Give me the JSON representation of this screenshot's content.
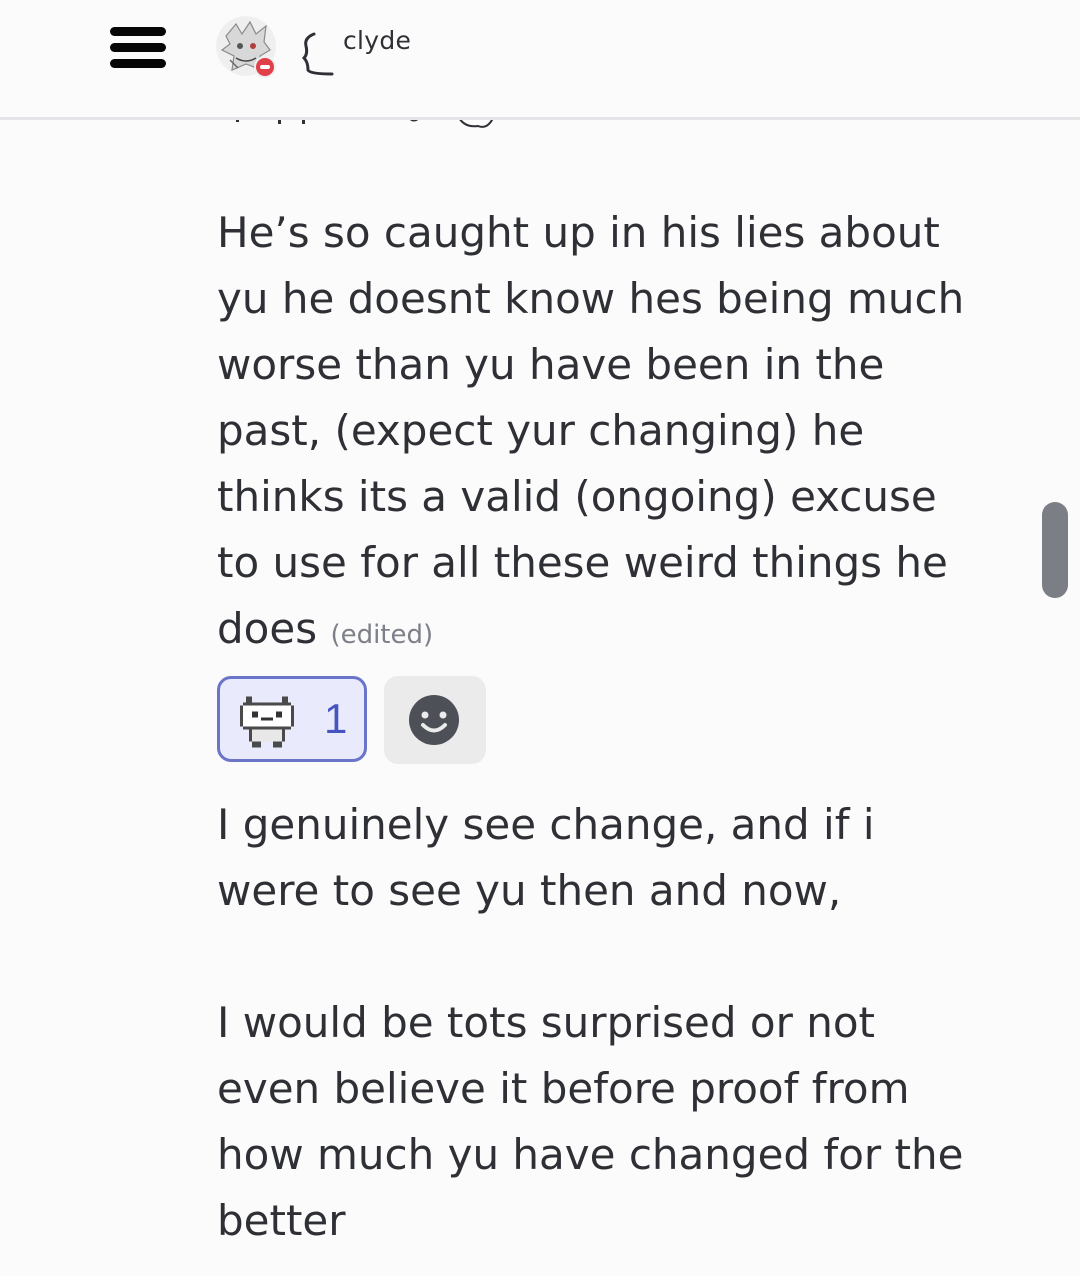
{
  "header": {
    "channel_name": "clyde"
  },
  "messages": {
    "first_message": "He’s so caught up in his lies about yu he doesnt know hes being much worse than yu have been in the past, (expect yur changing) he thinks its a valid (ongoing) excuse to use for all these weird things he does",
    "edited_label": "(edited)",
    "reaction_count": "1",
    "second_message_line1": "I genuinely see change, and if i were to see yu then and now,",
    "second_message_line2": "I would be tots surprised or not even believe it before proof from how much yu have changed for the better"
  },
  "icons": {
    "menu": "hamburger-menu-icon",
    "status": "do-not-disturb-icon",
    "thread": "thread-spine-icon",
    "reaction_emoji": "pixel-cat-icon",
    "add_reaction": "smiley-face-icon"
  },
  "colors": {
    "reaction_border": "#6a74c9",
    "reaction_bg": "#e9ebfc",
    "reaction_count": "#4654c0",
    "dnd_status": "#e0404a"
  }
}
